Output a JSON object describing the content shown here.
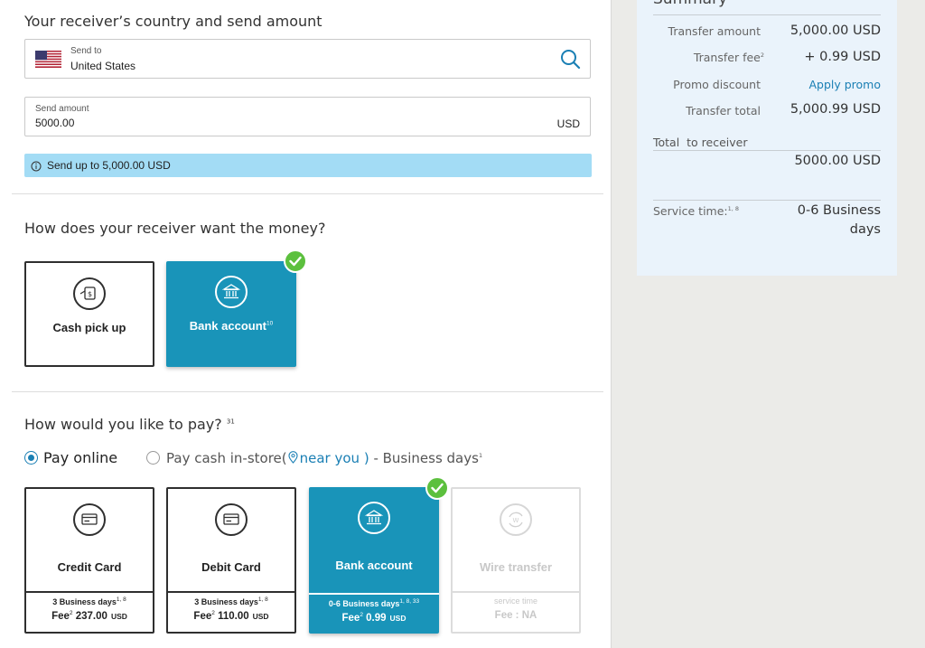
{
  "country_section": {
    "heading": "Your receiver’s country and send amount",
    "send_to_label": "Send to",
    "send_to_value": "United States",
    "amount_label": "Send amount",
    "amount_value": "5000.00",
    "amount_currency": "USD",
    "limit_info": "Send up to 5,000.00 USD"
  },
  "receive_section": {
    "heading": "How does your receiver want the money?",
    "options": [
      {
        "label": "Cash pick up",
        "sup": "",
        "icon": "cash-hand-icon",
        "selected": false
      },
      {
        "label": "Bank account",
        "sup": "10",
        "icon": "bank-icon",
        "selected": true
      }
    ]
  },
  "pay_section": {
    "heading": "How would you like to pay?",
    "heading_sup": "31",
    "pay_online": "Pay online",
    "pay_cash_prefix": "Pay cash in-store(",
    "near_you": "near you )",
    "pay_cash_suffix": " - Business days",
    "pay_cash_sup": "1",
    "methods": [
      {
        "label": "Credit Card",
        "time": "3 Business days",
        "time_sup": "1, 8",
        "fee_label": "Fee",
        "fee_sup": "2",
        "fee": "237.00",
        "currency": "USD",
        "icon": "card-icon",
        "state": "normal"
      },
      {
        "label": "Debit Card",
        "time": "3 Business days",
        "time_sup": "1, 8",
        "fee_label": "Fee",
        "fee_sup": "2",
        "fee": "110.00",
        "currency": "USD",
        "icon": "card-icon",
        "state": "normal"
      },
      {
        "label": "Bank account",
        "time": "0-6 Business days",
        "time_sup": "1, 8, 33",
        "fee_label": "Fee",
        "fee_sup": "2",
        "fee": "0.99",
        "currency": "USD",
        "icon": "bank-icon",
        "state": "selected"
      },
      {
        "label": "Wire transfer",
        "time": "service time",
        "fee_text": "Fee : NA",
        "icon": "wire-transfer-icon",
        "state": "disabled"
      }
    ]
  },
  "summary": {
    "title": "Summary",
    "transfer_amount_label": "Transfer amount",
    "transfer_amount": "5,000.00 USD",
    "transfer_fee_label": "Transfer fee",
    "transfer_fee_sup": "2",
    "transfer_fee": "+ 0.99 USD",
    "promo_label": "Promo discount",
    "promo_link": "Apply promo",
    "total_label": "Transfer total",
    "total": "5,000.99 USD",
    "receiver_label": "Total  to receiver",
    "receiver_total": "5000.00 USD",
    "service_time_label": "Service time:",
    "service_time_sup": "1, 8",
    "service_time_line1": "0-6 Business",
    "service_time_line2": "days"
  },
  "colors": {
    "accent": "#1994b9",
    "link": "#1a7fb4",
    "success": "#5cc03e",
    "info_bar": "#a3dcf5",
    "summary_bg": "#eaf3fb"
  }
}
